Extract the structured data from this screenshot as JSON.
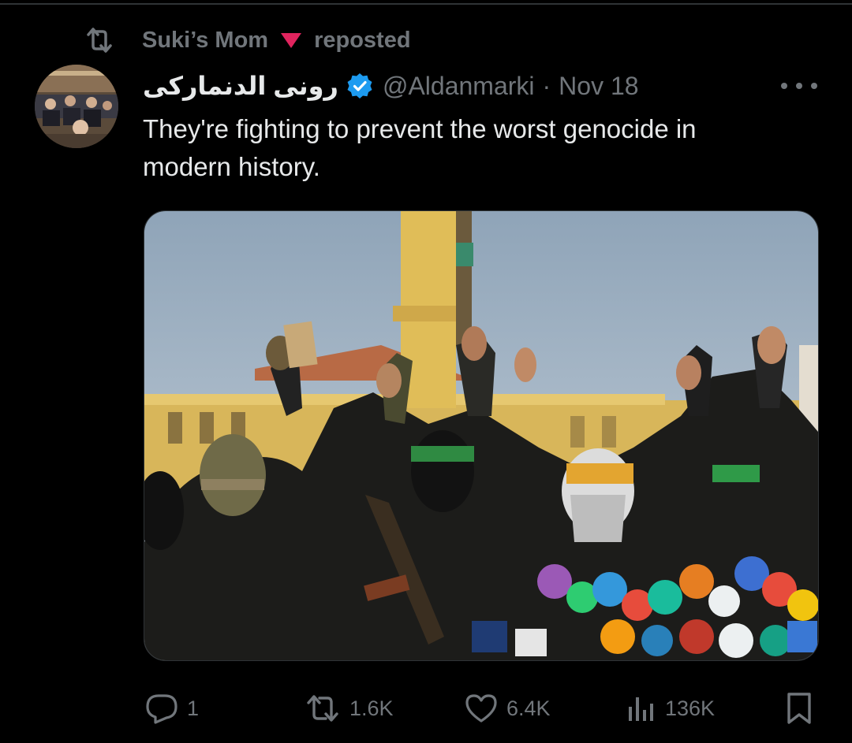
{
  "repost": {
    "user": "Suki’s Mom",
    "label": "reposted",
    "icon": "repost-icon",
    "emoji": "red-triangle-down-emoji"
  },
  "tweet": {
    "display_name": "رونى الدنماركى",
    "verified": true,
    "handle": "@Aldanmarki",
    "separator": "·",
    "date": "Nov 18",
    "text_line1": "They're fighting to prevent the worst genocide in",
    "text_line2": "modern history.",
    "media": {
      "description_icon": "photo"
    }
  },
  "actions": {
    "replies": "1",
    "reposts": "1.6K",
    "likes": "6.4K",
    "views": "136K"
  },
  "colors": {
    "background": "#000000",
    "primary_text": "#e7e9ea",
    "secondary_text": "#71767b",
    "verified_blue": "#1d9bf0",
    "divider": "#2f3336"
  }
}
